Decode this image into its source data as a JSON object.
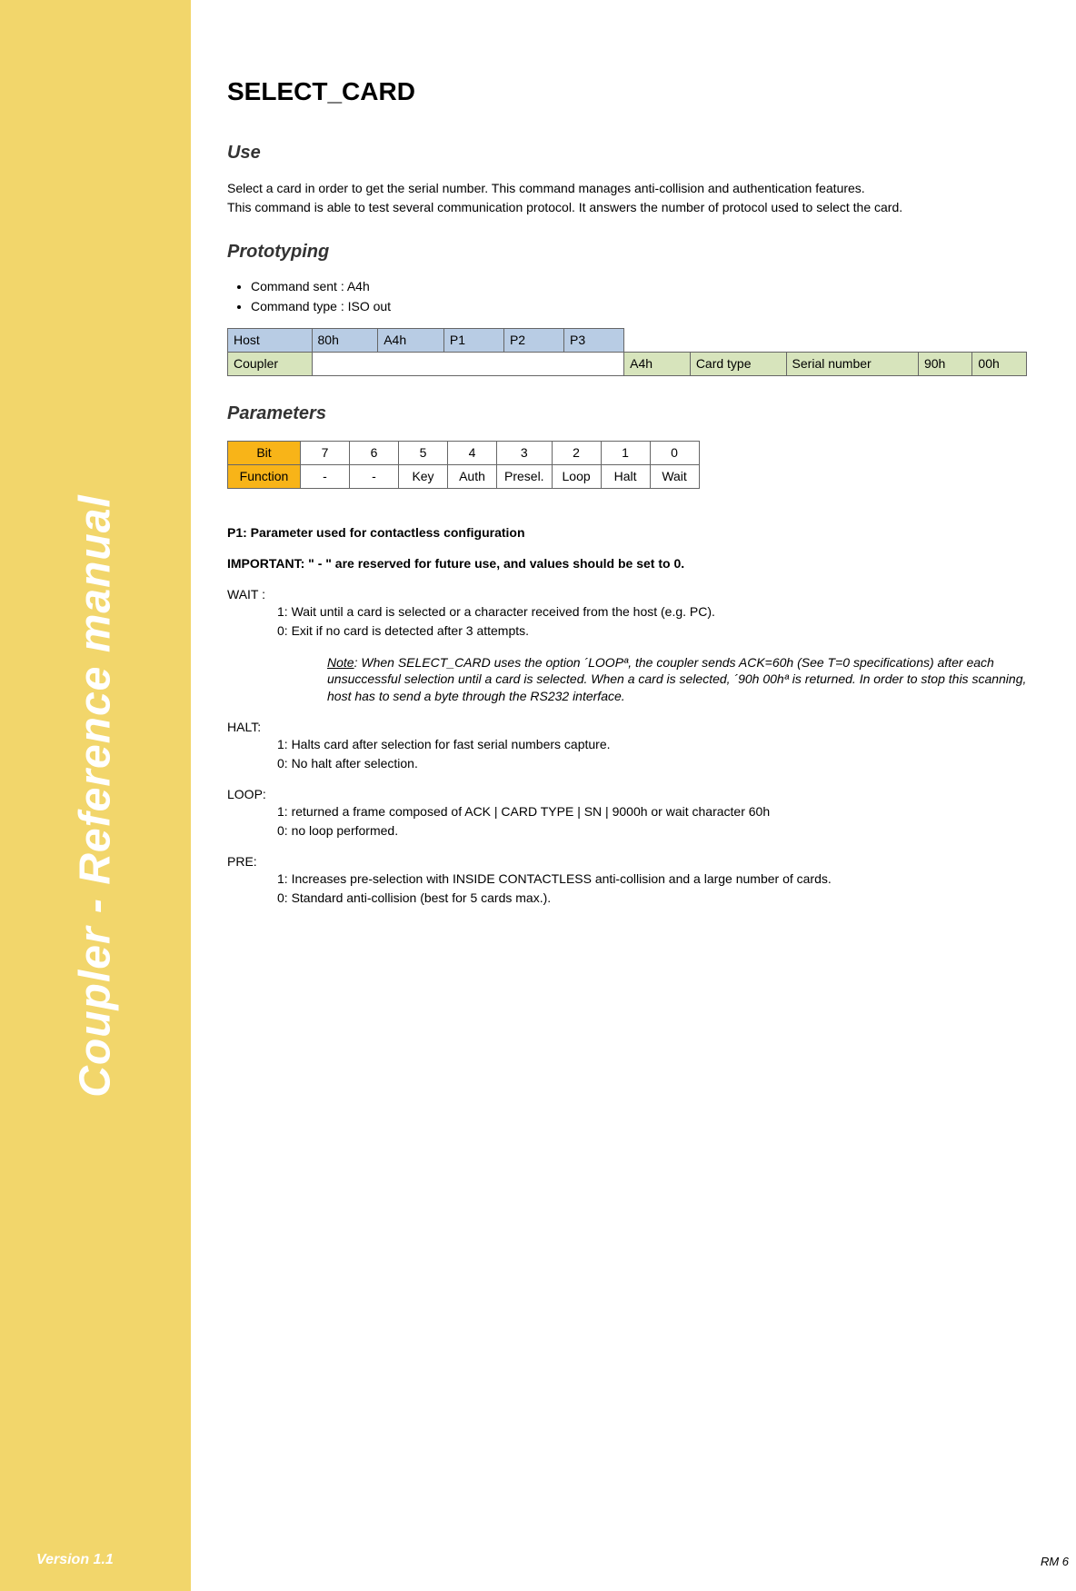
{
  "sidebar": {
    "title": "Coupler - Reference manual",
    "version": "Version 1.1"
  },
  "footer": {
    "page_ref": "RM 6"
  },
  "page": {
    "title": "SELECT_CARD",
    "use": {
      "heading": "Use",
      "p1": "Select a card in order to get the serial number. This command manages anti-collision and authentication features.",
      "p2": "This command is able to test several communication protocol. It answers the number of protocol used to select the card."
    },
    "prototyping": {
      "heading": "Prototyping",
      "bullets": [
        "Command sent : A4h",
        "Command type : ISO out"
      ],
      "table": {
        "host": {
          "label": "Host",
          "c1": "80h",
          "c2": "A4h",
          "c3": "P1",
          "c4": "P2",
          "c5": "P3"
        },
        "coupler": {
          "label": "Coupler",
          "r1": "A4h",
          "r2": "Card type",
          "r3": "Serial number",
          "r4": "90h",
          "r5": "00h"
        }
      }
    },
    "parameters": {
      "heading": "Parameters",
      "bit_row": {
        "label": "Bit",
        "b7": "7",
        "b6": "6",
        "b5": "5",
        "b4": "4",
        "b3": "3",
        "b2": "2",
        "b1": "1",
        "b0": "0"
      },
      "func_row": {
        "label": "Function",
        "b7": "-",
        "b6": "-",
        "b5": "Key",
        "b4": "Auth",
        "b3": "Presel.",
        "b2": "Loop",
        "b1": "Halt",
        "b0": "Wait"
      },
      "p1_heading": "P1: Parameter used for contactless configuration",
      "important": "IMPORTANT: \" - \" are reserved for future use, and values should be set to 0.",
      "wait": {
        "label": "WAIT :",
        "l1": "1: Wait until a card is selected or a character received from the host (e.g. PC).",
        "l0": "0: Exit if no card is detected after 3 attempts.",
        "note_label": "Note",
        "note_body": ": When SELECT_CARD uses the option ´LOOPª, the coupler sends ACK=60h (See T=0 specifications) after each unsuccessful selection until a card is selected. When a card is selected, ´90h 00hª is returned. In order to stop this scanning, host has to send a byte through the RS232 interface."
      },
      "halt": {
        "label": "HALT:",
        "l1": "1: Halts card after selection for fast serial numbers capture.",
        "l0": "0: No halt after selection."
      },
      "loop": {
        "label": "LOOP:",
        "l1": "1: returned a frame composed of ACK | CARD TYPE | SN | 9000h or wait character 60h",
        "l0": "0: no loop performed."
      },
      "pre": {
        "label": "PRE:",
        "l1": "1: Increases pre-selection with INSIDE CONTACTLESS anti-collision and a large number of cards.",
        "l0": "0: Standard anti-collision (best for 5 cards max.)."
      }
    }
  }
}
